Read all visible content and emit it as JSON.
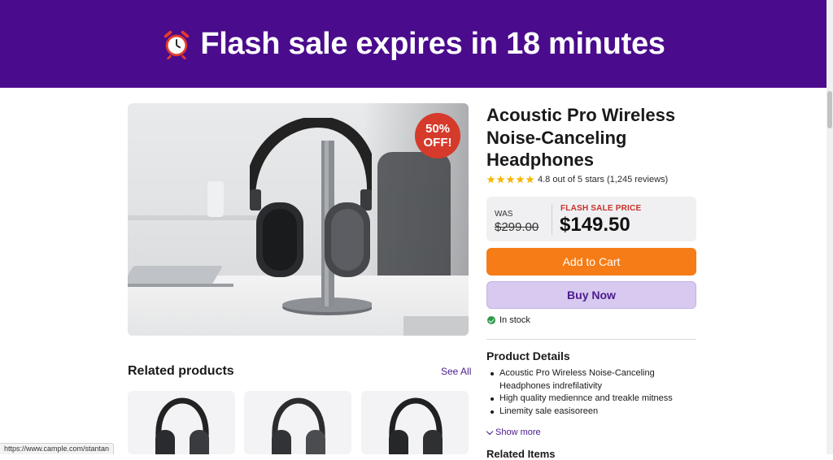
{
  "banner": {
    "text": "Flash sale expires in 18 minutes",
    "icon": "alarm-clock-icon",
    "color": "#4a0b8c"
  },
  "product": {
    "badge_top": "50%",
    "badge_bottom": "OFF!",
    "title": "Acoustic Pro Wireless Noise-Canceling Headphones",
    "rating_value": 4.8,
    "rating_text": "4.8 out of 5 stars (1,245 reviews)",
    "was_label": "WAS",
    "was_price": "$299.00",
    "sale_label": "FLASH SALE PRICE",
    "sale_price": "$149.50",
    "add_to_cart": "Add to Cart",
    "buy_now": "Buy Now",
    "stock": "In stock"
  },
  "details": {
    "heading": "Product Details",
    "items": [
      "Acoustic Pro Wireless Noise-Canceling Headphones indrefilativity",
      "High quality mediennce and treakle mitness",
      "Linemity sale easisoreen"
    ],
    "show_more": "Show more",
    "related_items_heading": "Related Items"
  },
  "related": {
    "heading": "Related products",
    "see_all": "See All"
  },
  "status_bar": {
    "url": "https://www.cample.com/stantan"
  },
  "colors": {
    "accent": "#4a1b8c",
    "cart": "#f57c16",
    "buy": "#d7c9ef",
    "badge": "#d63a2a",
    "sale_label": "#c8322b",
    "in_stock": "#2e9a4a"
  }
}
